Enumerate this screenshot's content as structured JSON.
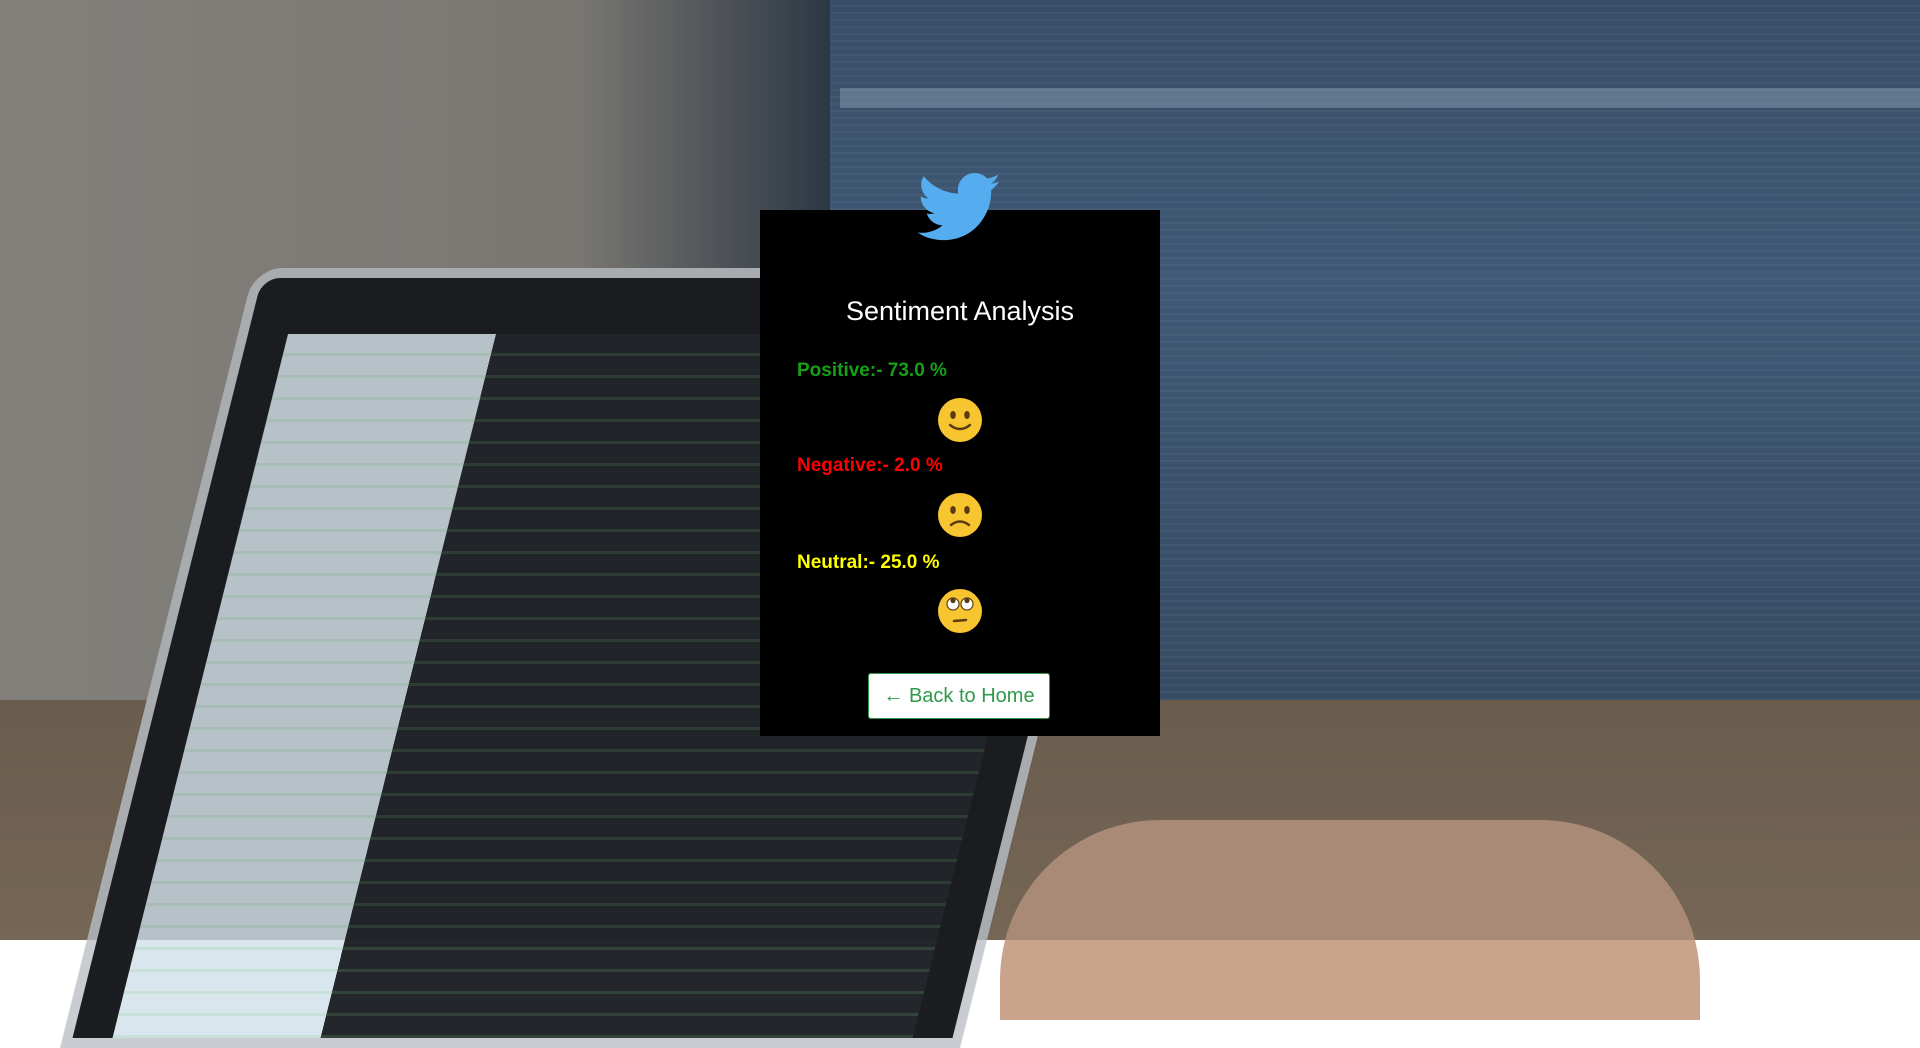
{
  "page": {
    "title": "Sentiment Analysis"
  },
  "results": {
    "positive": {
      "text": "Positive:- 73.0 %",
      "value": 73.0,
      "color": "#16a016",
      "icon": "smiling-face-icon"
    },
    "negative": {
      "text": "Negative:- 2.0 %",
      "value": 2.0,
      "color": "#ff0000",
      "icon": "frowning-face-icon"
    },
    "neutral": {
      "text": "Neutral:- 25.0 %",
      "value": 25.0,
      "color": "#ffff00",
      "icon": "eye-roll-face-icon"
    }
  },
  "actions": {
    "back_label": "← Back to Home"
  },
  "colors": {
    "card_background": "#000000",
    "twitter_blue": "#55acee",
    "button_green": "#2e9a4a"
  },
  "icons": {
    "logo": "twitter-bird-icon"
  }
}
